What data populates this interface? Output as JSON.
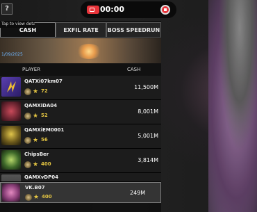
{
  "help": {
    "label": "?",
    "tooltip": "Tap to view details."
  },
  "recording": {
    "time": "00:00"
  },
  "tabs": [
    {
      "label": "CASH",
      "active": true
    },
    {
      "label": "EXFIL RATE",
      "active": false
    },
    {
      "label": "BOSS SPEEDRUN",
      "active": false
    }
  ],
  "banner": {
    "date": "1/09/2025"
  },
  "table_header": {
    "player": "PLAYER",
    "cash": "CASH"
  },
  "rows": [
    {
      "name": "QATXi07km07",
      "level": "72",
      "cash": "11,500M"
    },
    {
      "name": "QAMXiDA04",
      "level": "52",
      "cash": "8,001M"
    },
    {
      "name": "QAMXiEM0001",
      "level": "56",
      "cash": "5,001M"
    },
    {
      "name": "ChipsBer",
      "level": "400",
      "cash": "3,814M"
    },
    {
      "name": "QAMXvDP04",
      "level": "",
      "cash": ""
    }
  ],
  "me": {
    "name": "VK.B07",
    "level": "400",
    "cash": "249M"
  },
  "colors": {
    "accent_gold": "#e4c542",
    "record_red": "#e8343a",
    "date_blue": "#6fb6ff"
  }
}
